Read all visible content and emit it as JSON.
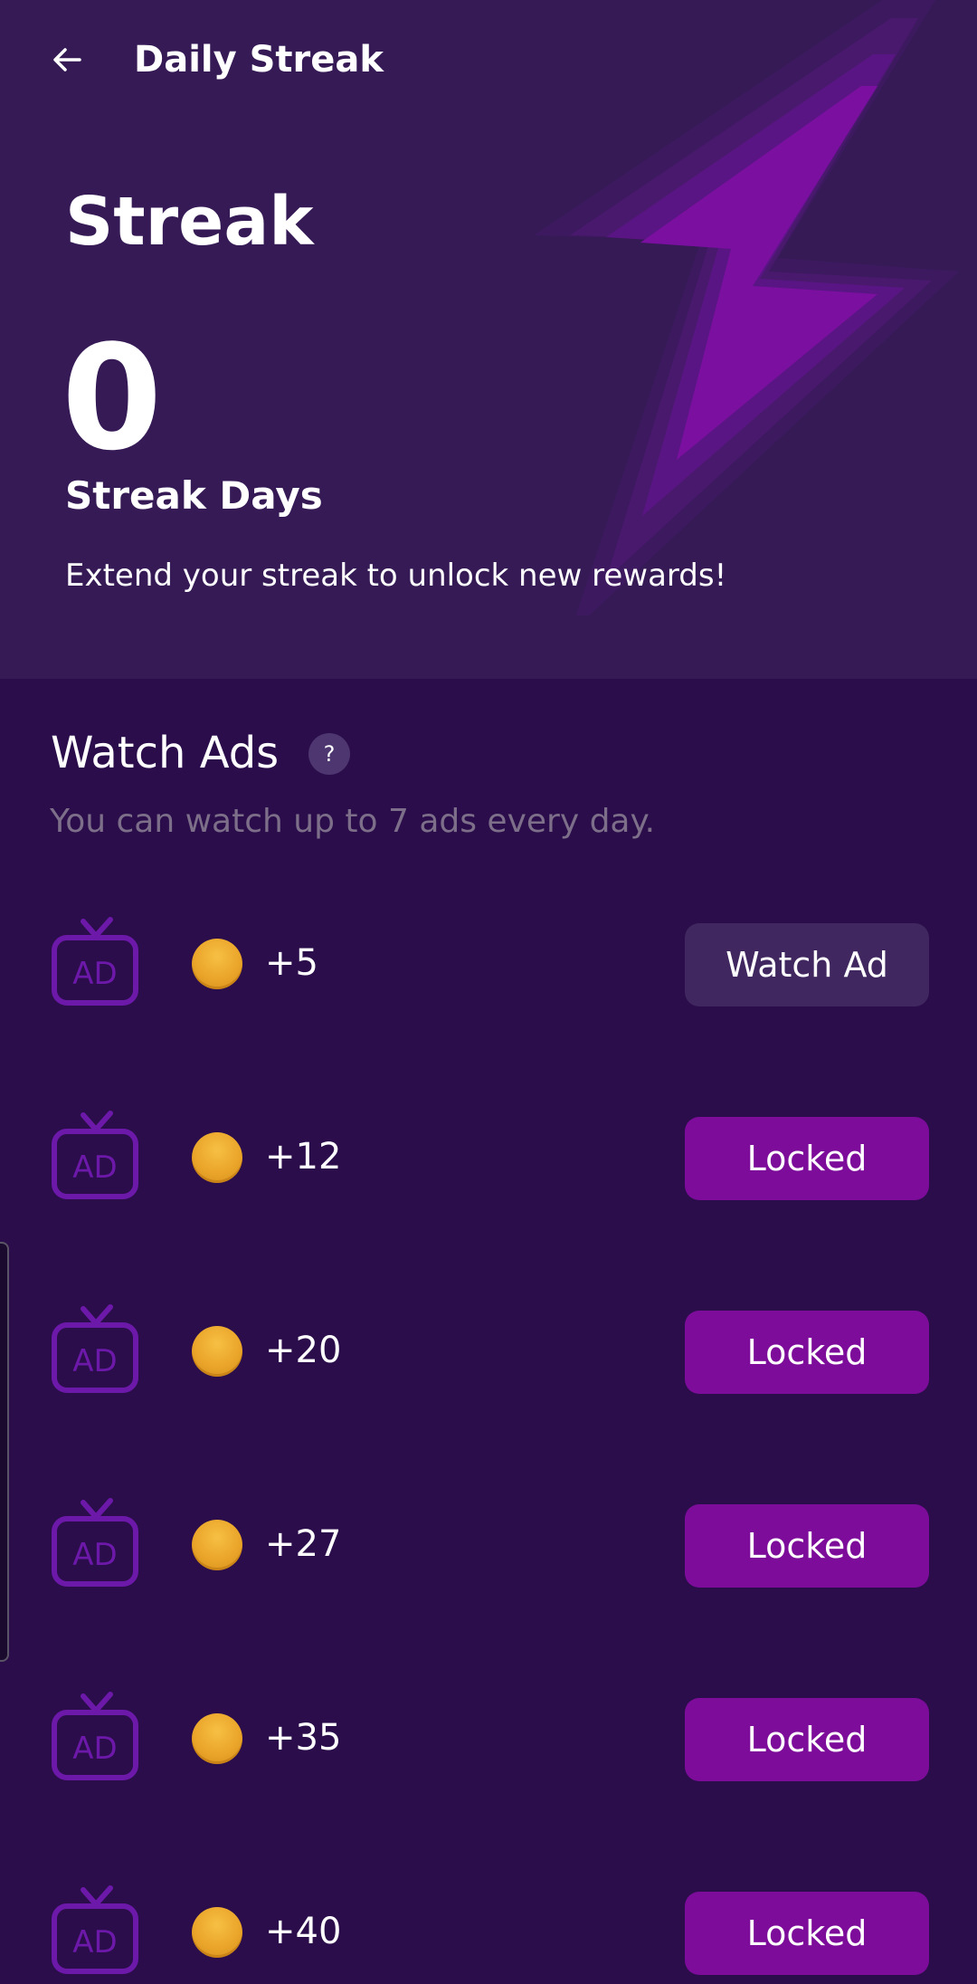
{
  "header": {
    "back_icon": "arrow-left-icon",
    "title": "Daily Streak"
  },
  "hero": {
    "heading": "Streak",
    "count": "0",
    "count_label": "Streak Days",
    "description": "Extend your streak to unlock new rewards!",
    "decor_icon": "lightning-bolt-icon"
  },
  "watch_ads": {
    "title": "Watch Ads",
    "help_label": "?",
    "subtitle": "You can watch up to 7 ads every day.",
    "items": [
      {
        "reward": "+5",
        "button": "Watch Ad",
        "state": "available"
      },
      {
        "reward": "+12",
        "button": "Locked",
        "state": "locked"
      },
      {
        "reward": "+20",
        "button": "Locked",
        "state": "locked"
      },
      {
        "reward": "+27",
        "button": "Locked",
        "state": "locked"
      },
      {
        "reward": "+35",
        "button": "Locked",
        "state": "locked"
      },
      {
        "reward": "+40",
        "button": "Locked",
        "state": "locked"
      }
    ]
  },
  "colors": {
    "hero_bg": "#351a55",
    "page_bg": "#2a0d4a",
    "accent_purple": "#7c0c99",
    "watch_button_bg": "#40275f",
    "coin_gold": "#eaa52a",
    "muted_text": "#7d6f8a"
  }
}
